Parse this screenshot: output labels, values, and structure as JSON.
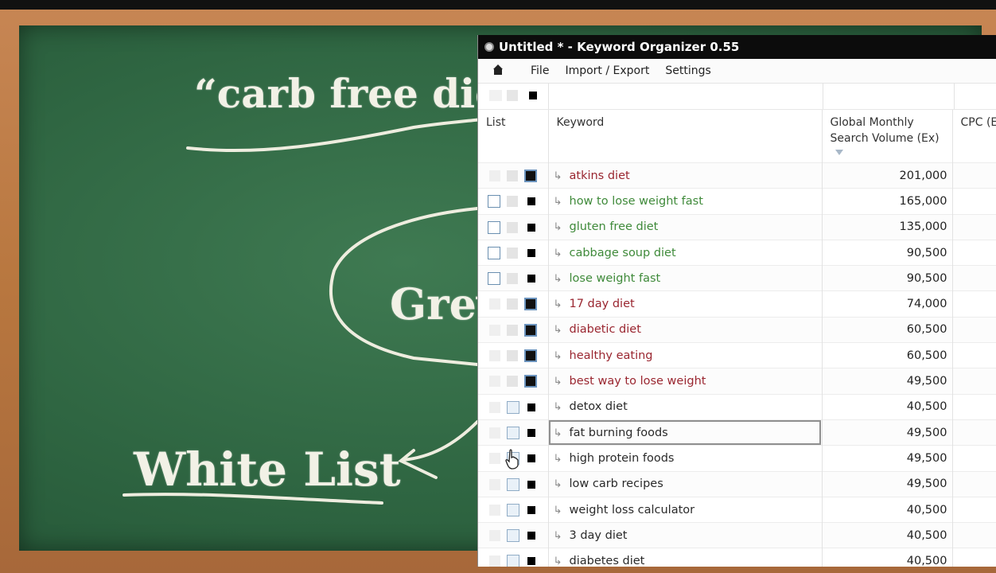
{
  "board": {
    "quote_text": "“carb free diet",
    "grey_text": "Grey",
    "white_list_text": "White List"
  },
  "window": {
    "title": "Untitled * - Keyword Organizer 0.55",
    "menu": [
      "File",
      "Import / Export",
      "Settings"
    ],
    "columns": {
      "list": "List",
      "keyword": "Keyword",
      "volume": "Global Monthly Search Volume (Ex)",
      "cpc": "CPC (E"
    },
    "rows": [
      {
        "keyword": "atkins diet",
        "volume": "201,000",
        "color": "red",
        "list": "black"
      },
      {
        "keyword": "how to lose weight fast",
        "volume": "165,000",
        "color": "green",
        "list": "white"
      },
      {
        "keyword": "gluten free diet",
        "volume": "135,000",
        "color": "green",
        "list": "white"
      },
      {
        "keyword": "cabbage soup diet",
        "volume": "90,500",
        "color": "green",
        "list": "white"
      },
      {
        "keyword": "lose weight fast",
        "volume": "90,500",
        "color": "green",
        "list": "white"
      },
      {
        "keyword": "17 day diet",
        "volume": "74,000",
        "color": "red",
        "list": "black"
      },
      {
        "keyword": "diabetic diet",
        "volume": "60,500",
        "color": "red",
        "list": "black"
      },
      {
        "keyword": "healthy eating",
        "volume": "60,500",
        "color": "red",
        "list": "black"
      },
      {
        "keyword": "best way to lose weight",
        "volume": "49,500",
        "color": "red",
        "list": "black"
      },
      {
        "keyword": "detox diet",
        "volume": "40,500",
        "color": "dark",
        "list": "grey"
      },
      {
        "keyword": "fat burning foods",
        "volume": "49,500",
        "color": "dark",
        "list": "grey",
        "selected": true
      },
      {
        "keyword": "high protein foods",
        "volume": "49,500",
        "color": "dark",
        "list": "grey",
        "cursor": true
      },
      {
        "keyword": "low carb recipes",
        "volume": "49,500",
        "color": "dark",
        "list": "grey"
      },
      {
        "keyword": "weight loss calculator",
        "volume": "40,500",
        "color": "dark",
        "list": "grey"
      },
      {
        "keyword": "3 day diet",
        "volume": "40,500",
        "color": "dark",
        "list": "grey"
      },
      {
        "keyword": "diabetes diet",
        "volume": "40,500",
        "color": "dark",
        "list": "grey"
      }
    ],
    "colors": {
      "red": "#9a2630",
      "green": "#3f8a3a",
      "dark": "#2a2a2a"
    }
  }
}
